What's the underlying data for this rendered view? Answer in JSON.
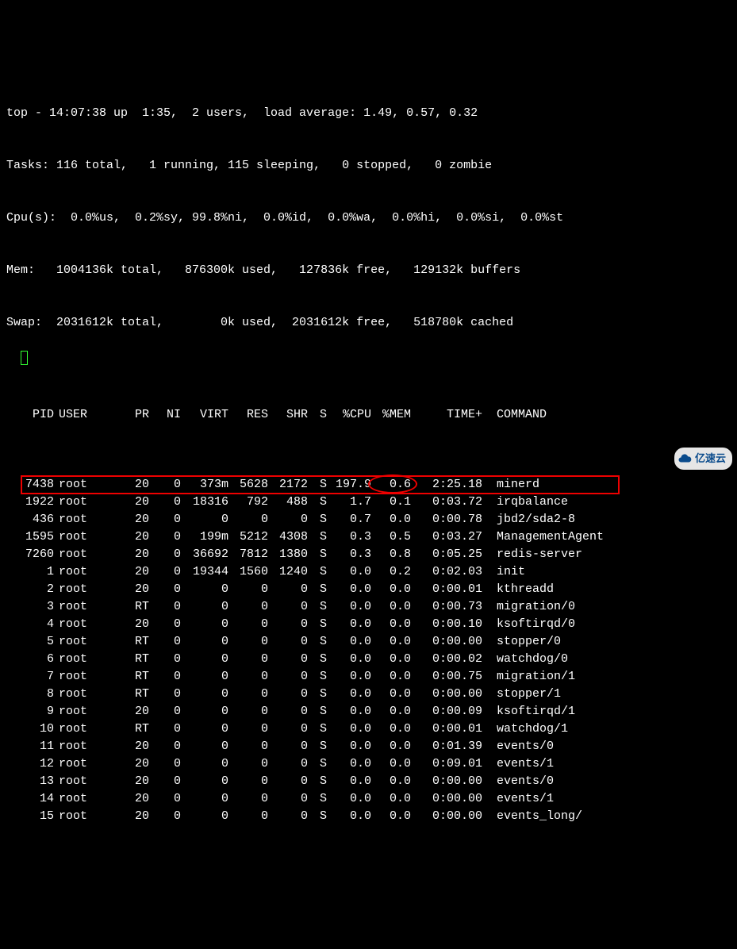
{
  "summary": {
    "line1": "top - 14:07:38 up  1:35,  2 users,  load average: 1.49, 0.57, 0.32",
    "line2": "Tasks: 116 total,   1 running, 115 sleeping,   0 stopped,   0 zombie",
    "line3": "Cpu(s):  0.0%us,  0.2%sy, 99.8%ni,  0.0%id,  0.0%wa,  0.0%hi,  0.0%si,  0.0%st",
    "line4": "Mem:   1004136k total,   876300k used,   127836k free,   129132k buffers",
    "line5": "Swap:  2031612k total,        0k used,  2031612k free,   518780k cached"
  },
  "headers": {
    "pid": "PID",
    "user": "USER",
    "pr": "PR",
    "ni": "NI",
    "virt": "VIRT",
    "res": "RES",
    "shr": "SHR",
    "s": "S",
    "cpu": "%CPU",
    "mem": "%MEM",
    "time": "TIME+",
    "cmd": "COMMAND"
  },
  "rows": [
    {
      "pid": "7438",
      "user": "root",
      "pr": "20",
      "ni": "0",
      "virt": "373m",
      "res": "5628",
      "shr": "2172",
      "s": "S",
      "cpu": "197.9",
      "mem": "0.6",
      "time": "2:25.18",
      "cmd": "minerd",
      "highlighted": true
    },
    {
      "pid": "1922",
      "user": "root",
      "pr": "20",
      "ni": "0",
      "virt": "18316",
      "res": "792",
      "shr": "488",
      "s": "S",
      "cpu": "1.7",
      "mem": "0.1",
      "time": "0:03.72",
      "cmd": "irqbalance"
    },
    {
      "pid": "436",
      "user": "root",
      "pr": "20",
      "ni": "0",
      "virt": "0",
      "res": "0",
      "shr": "0",
      "s": "S",
      "cpu": "0.7",
      "mem": "0.0",
      "time": "0:00.78",
      "cmd": "jbd2/sda2-8"
    },
    {
      "pid": "1595",
      "user": "root",
      "pr": "20",
      "ni": "0",
      "virt": "199m",
      "res": "5212",
      "shr": "4308",
      "s": "S",
      "cpu": "0.3",
      "mem": "0.5",
      "time": "0:03.27",
      "cmd": "ManagementAgent"
    },
    {
      "pid": "7260",
      "user": "root",
      "pr": "20",
      "ni": "0",
      "virt": "36692",
      "res": "7812",
      "shr": "1380",
      "s": "S",
      "cpu": "0.3",
      "mem": "0.8",
      "time": "0:05.25",
      "cmd": "redis-server"
    },
    {
      "pid": "1",
      "user": "root",
      "pr": "20",
      "ni": "0",
      "virt": "19344",
      "res": "1560",
      "shr": "1240",
      "s": "S",
      "cpu": "0.0",
      "mem": "0.2",
      "time": "0:02.03",
      "cmd": "init"
    },
    {
      "pid": "2",
      "user": "root",
      "pr": "20",
      "ni": "0",
      "virt": "0",
      "res": "0",
      "shr": "0",
      "s": "S",
      "cpu": "0.0",
      "mem": "0.0",
      "time": "0:00.01",
      "cmd": "kthreadd"
    },
    {
      "pid": "3",
      "user": "root",
      "pr": "RT",
      "ni": "0",
      "virt": "0",
      "res": "0",
      "shr": "0",
      "s": "S",
      "cpu": "0.0",
      "mem": "0.0",
      "time": "0:00.73",
      "cmd": "migration/0"
    },
    {
      "pid": "4",
      "user": "root",
      "pr": "20",
      "ni": "0",
      "virt": "0",
      "res": "0",
      "shr": "0",
      "s": "S",
      "cpu": "0.0",
      "mem": "0.0",
      "time": "0:00.10",
      "cmd": "ksoftirqd/0"
    },
    {
      "pid": "5",
      "user": "root",
      "pr": "RT",
      "ni": "0",
      "virt": "0",
      "res": "0",
      "shr": "0",
      "s": "S",
      "cpu": "0.0",
      "mem": "0.0",
      "time": "0:00.00",
      "cmd": "stopper/0"
    },
    {
      "pid": "6",
      "user": "root",
      "pr": "RT",
      "ni": "0",
      "virt": "0",
      "res": "0",
      "shr": "0",
      "s": "S",
      "cpu": "0.0",
      "mem": "0.0",
      "time": "0:00.02",
      "cmd": "watchdog/0"
    },
    {
      "pid": "7",
      "user": "root",
      "pr": "RT",
      "ni": "0",
      "virt": "0",
      "res": "0",
      "shr": "0",
      "s": "S",
      "cpu": "0.0",
      "mem": "0.0",
      "time": "0:00.75",
      "cmd": "migration/1"
    },
    {
      "pid": "8",
      "user": "root",
      "pr": "RT",
      "ni": "0",
      "virt": "0",
      "res": "0",
      "shr": "0",
      "s": "S",
      "cpu": "0.0",
      "mem": "0.0",
      "time": "0:00.00",
      "cmd": "stopper/1"
    },
    {
      "pid": "9",
      "user": "root",
      "pr": "20",
      "ni": "0",
      "virt": "0",
      "res": "0",
      "shr": "0",
      "s": "S",
      "cpu": "0.0",
      "mem": "0.0",
      "time": "0:00.09",
      "cmd": "ksoftirqd/1"
    },
    {
      "pid": "10",
      "user": "root",
      "pr": "RT",
      "ni": "0",
      "virt": "0",
      "res": "0",
      "shr": "0",
      "s": "S",
      "cpu": "0.0",
      "mem": "0.0",
      "time": "0:00.01",
      "cmd": "watchdog/1"
    },
    {
      "pid": "11",
      "user": "root",
      "pr": "20",
      "ni": "0",
      "virt": "0",
      "res": "0",
      "shr": "0",
      "s": "S",
      "cpu": "0.0",
      "mem": "0.0",
      "time": "0:01.39",
      "cmd": "events/0"
    },
    {
      "pid": "12",
      "user": "root",
      "pr": "20",
      "ni": "0",
      "virt": "0",
      "res": "0",
      "shr": "0",
      "s": "S",
      "cpu": "0.0",
      "mem": "0.0",
      "time": "0:09.01",
      "cmd": "events/1"
    },
    {
      "pid": "13",
      "user": "root",
      "pr": "20",
      "ni": "0",
      "virt": "0",
      "res": "0",
      "shr": "0",
      "s": "S",
      "cpu": "0.0",
      "mem": "0.0",
      "time": "0:00.00",
      "cmd": "events/0"
    },
    {
      "pid": "14",
      "user": "root",
      "pr": "20",
      "ni": "0",
      "virt": "0",
      "res": "0",
      "shr": "0",
      "s": "S",
      "cpu": "0.0",
      "mem": "0.0",
      "time": "0:00.00",
      "cmd": "events/1"
    },
    {
      "pid": "15",
      "user": "root",
      "pr": "20",
      "ni": "0",
      "virt": "0",
      "res": "0",
      "shr": "0",
      "s": "S",
      "cpu": "0.0",
      "mem": "0.0",
      "time": "0:00.00",
      "cmd": "events_long/"
    }
  ],
  "watermark": {
    "text": "亿速云"
  }
}
